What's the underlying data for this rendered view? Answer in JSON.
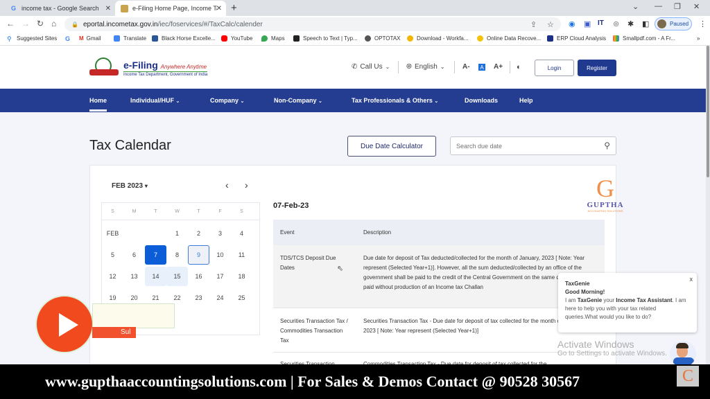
{
  "browser": {
    "tabs": [
      {
        "title": "income tax - Google Search",
        "favicon": "google-icon",
        "active": false
      },
      {
        "title": "e-Filing Home Page, Income Tax",
        "favicon": "efiling-icon",
        "active": true
      }
    ],
    "new_tab": "+",
    "url_host": "eportal.incometax.gov.in",
    "url_path": "/iec/foservices/#/TaxCalc/calender",
    "profile_status": "Paused",
    "bookmarks": [
      {
        "label": "Suggested Sites",
        "color": "#1a73e8"
      },
      {
        "label": "",
        "color": "#4285f4"
      },
      {
        "label": "Gmail",
        "color": "#d93025"
      },
      {
        "label": "Translate",
        "color": "#4285f4"
      },
      {
        "label": "Black Horse Excelle...",
        "color": "#2b5797"
      },
      {
        "label": "YouTube",
        "color": "#ff0000"
      },
      {
        "label": "Maps",
        "color": "#34a853"
      },
      {
        "label": "Speech to Text | Typ...",
        "color": "#222222"
      },
      {
        "label": "OPTOTAX",
        "color": "#555555"
      },
      {
        "label": "Download - Workfa...",
        "color": "#f4b400"
      },
      {
        "label": "Online Data Recove...",
        "color": "#f4c20d"
      },
      {
        "label": "ERP Cloud Analysis",
        "color": "#1b2f87"
      },
      {
        "label": "Smallpdf.com - A Fr...",
        "color": "#e94e77"
      }
    ],
    "bookmarks_overflow": "»"
  },
  "site": {
    "logo_title": "e-Filing",
    "logo_tagline": "Anywhere Anytime",
    "logo_sub": "Income Tax Department, Government of India",
    "call_us": "Call Us",
    "language": "English",
    "font_decrease": "A-",
    "font_normal": "A",
    "font_increase": "A+",
    "login": "Login",
    "register": "Register",
    "nav": [
      {
        "label": "Home",
        "active": true
      },
      {
        "label": "Individual/HUF",
        "dropdown": true
      },
      {
        "label": "Company",
        "dropdown": true
      },
      {
        "label": "Non-Company",
        "dropdown": true
      },
      {
        "label": "Tax Professionals & Others",
        "dropdown": true
      },
      {
        "label": "Downloads"
      },
      {
        "label": "Help"
      }
    ]
  },
  "page": {
    "title": "Tax Calendar",
    "due_date_calculator": "Due Date Calculator",
    "search_placeholder": "Search due date",
    "calendar": {
      "month_label": "FEB 2023",
      "weekdays": [
        "S",
        "M",
        "T",
        "W",
        "T",
        "F",
        "S"
      ],
      "month_short": "FEB",
      "selected_day": 7,
      "today_day": 9,
      "highlight_days": [
        14,
        15
      ],
      "rows": [
        [
          "FEB",
          "",
          "",
          "1",
          "2",
          "3",
          "4"
        ],
        [
          "5",
          "6",
          "7",
          "8",
          "9",
          "10",
          "11"
        ],
        [
          "12",
          "13",
          "14",
          "15",
          "16",
          "17",
          "18"
        ],
        [
          "19",
          "20",
          "21",
          "22",
          "23",
          "24",
          "25"
        ]
      ]
    },
    "selected_date": "07-Feb-23",
    "table": {
      "headers": [
        "Event",
        "Description"
      ],
      "rows": [
        {
          "event": "TDS/TCS Deposit Due Dates",
          "description": "Due date for deposit of Tax deducted/collected for the month of January, 2023 [ Note: Year represent (Selected Year+1)]. However, all the sum deducted/collected by an office of the government shall be paid to the credit of the Central Government on the same day where tax is paid without production of an Income tax Challan"
        },
        {
          "event": "Securities Transaction Tax / Commodities Transaction Tax",
          "description": "Securities Transaction Tax - Due date for deposit of tax collected for the month of January, 2023 [ Note: Year represent (Selected Year+1)]"
        },
        {
          "event": "Securities Transaction",
          "description": "Commodities Transaction Tax - Due date for deposit of tax collected for the"
        }
      ]
    }
  },
  "chat": {
    "name": "TaxGenie",
    "greeting": "Good Morning!",
    "intro_1": "I am ",
    "intro_name": "TaxGenie",
    "intro_2": " your ",
    "intro_role": "Income Tax Assistant",
    "intro_3": ". I am here to help you with your tax related queries.What would you like to do?",
    "close": "x"
  },
  "overlay": {
    "watermark_brand": "GUPTHA",
    "watermark_sub": "ACCOUNTING SOLUTIONS",
    "subscribe_partial": "Sul",
    "activate_title": "Activate Windows",
    "activate_sub": "Go to Settings to activate Windows.",
    "banner": "www.gupthaaccountingsolutions.com | For Sales & Demos Contact @ 90528 30567"
  }
}
